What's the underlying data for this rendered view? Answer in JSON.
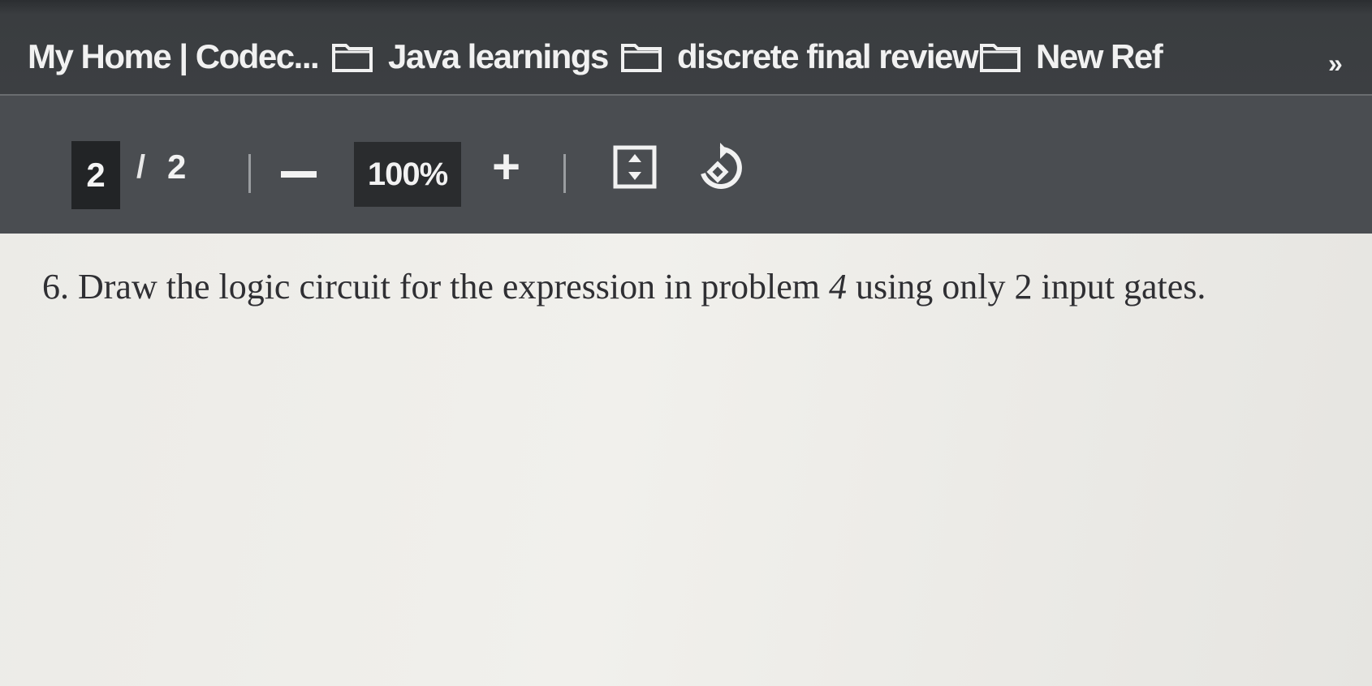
{
  "bookmarks_bar": {
    "items": [
      {
        "label": "My Home | Codec...",
        "icon": "none"
      },
      {
        "label": "Java learnings",
        "icon": "folder-icon"
      },
      {
        "label": "discrete final review",
        "icon": "folder-icon"
      },
      {
        "label": "New Ref",
        "icon": "folder-icon"
      }
    ],
    "overflow_label": "»"
  },
  "pdf_toolbar": {
    "current_page": "2",
    "page_separator": "/",
    "total_pages": "2",
    "zoom_level": "100%",
    "zoom_out_label": "−",
    "zoom_in_label": "+",
    "icons": [
      "fit-to-page-icon",
      "rotate-icon"
    ]
  },
  "document": {
    "question_prefix": "6. Draw the logic circuit for the expression in problem ",
    "question_problem_number": "4",
    "question_suffix": " using only 2 input gates."
  }
}
